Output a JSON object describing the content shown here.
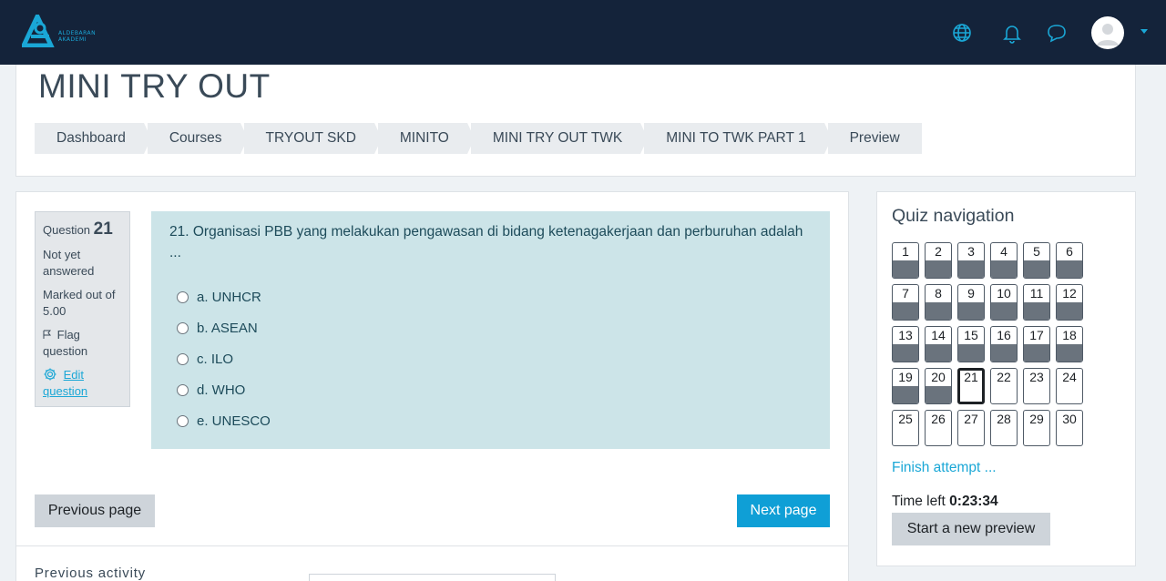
{
  "brand": {
    "name_line1": "ALDEBARAN",
    "name_line2": "AKADEMI",
    "accent": "#1aa7d6",
    "navbar_bg": "#14233a"
  },
  "navbar": {
    "icons": [
      "globe-icon",
      "bell-icon",
      "chat-icon"
    ],
    "avatar": "user-avatar"
  },
  "page": {
    "title": "MINI TRY OUT",
    "breadcrumb": [
      "Dashboard",
      "Courses",
      "TRYOUT SKD",
      "MINITO",
      "MINI TRY OUT TWK",
      "MINI TO TWK PART 1",
      "Preview"
    ]
  },
  "question": {
    "label": "Question",
    "number": "21",
    "status": "Not yet answered",
    "marked": "Marked out of 5.00",
    "flag_label": "Flag question",
    "edit_label": "Edit question",
    "text": "21. Organisasi PBB yang melakukan pengawasan di bidang ketenagakerjaan dan perburuhan adalah ...",
    "answers": [
      "a. UNHCR",
      "b. ASEAN",
      "c. ILO",
      "d. WHO",
      "e. UNESCO"
    ],
    "box_color": "#cce4e8"
  },
  "buttons": {
    "previous_page": "Previous page",
    "next_page": "Next page",
    "next_color": "#0f9fd6"
  },
  "footer": {
    "previous_activity": "Previous activity"
  },
  "quiz_nav": {
    "title": "Quiz navigation",
    "questions": [
      "1",
      "2",
      "3",
      "4",
      "5",
      "6",
      "7",
      "8",
      "9",
      "10",
      "11",
      "12",
      "13",
      "14",
      "15",
      "16",
      "17",
      "18",
      "19",
      "20",
      "21",
      "22",
      "23",
      "24",
      "25",
      "26",
      "27",
      "28",
      "29",
      "30"
    ],
    "answered_count": 20,
    "current": "21",
    "finish_label": "Finish attempt ...",
    "time_label": "Time left",
    "time_value": "0:23:34",
    "new_preview_label": "Start a new preview"
  }
}
